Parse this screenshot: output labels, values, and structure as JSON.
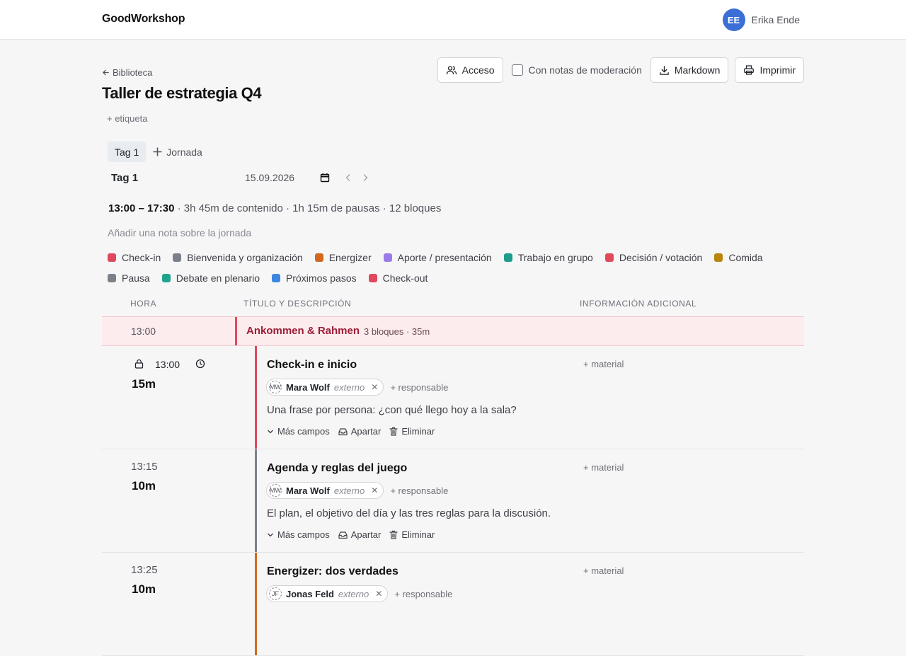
{
  "app": {
    "brand": "GoodWorkshop"
  },
  "user": {
    "initials": "EE",
    "name": "Erika Ende"
  },
  "header": {
    "back_label": "Biblioteca",
    "title": "Taller de estrategia Q4",
    "add_tag": "+ etiqueta"
  },
  "toolbar": {
    "access_label": "Acceso",
    "moderation_label": "Con notas de moderación",
    "moderation_checked": false,
    "markdown_label": "Markdown",
    "print_label": "Imprimir"
  },
  "days": {
    "tabs": [
      {
        "label": "Tag 1",
        "active": true
      }
    ],
    "add_label": "Jornada"
  },
  "day": {
    "name": "Tag 1",
    "date": "15.09.2026",
    "time_range": "13:00 – 17:30",
    "summary": " · 3h 45m de contenido · 1h 15m de pausas · 12 bloques",
    "note_placeholder": "Añadir una nota sobre la jornada"
  },
  "legend": [
    {
      "label": "Check-in",
      "color": "#e0485e"
    },
    {
      "label": "Bienvenida y organización",
      "color": "#7b8089"
    },
    {
      "label": "Energizer",
      "color": "#d2691e"
    },
    {
      "label": "Aporte / presentación",
      "color": "#9b7be8"
    },
    {
      "label": "Trabajo en grupo",
      "color": "#1f9c8a"
    },
    {
      "label": "Decisión / votación",
      "color": "#e04a5a"
    },
    {
      "label": "Comida",
      "color": "#b8860b"
    },
    {
      "label": "Pausa",
      "color": "#7b8089"
    },
    {
      "label": "Debate en plenario",
      "color": "#1fa38f"
    },
    {
      "label": "Próximos pasos",
      "color": "#3a86e0"
    },
    {
      "label": "Check-out",
      "color": "#e0485e"
    }
  ],
  "table": {
    "headers": {
      "time": "HORA",
      "title": "TÍTULO Y DESCRIPCIÓN",
      "info": "INFORMACIÓN ADICIONAL"
    }
  },
  "group": {
    "time": "13:00",
    "name": "Ankommen & Rahmen",
    "meta": "3 bloques · 35m",
    "color": "#e0485e"
  },
  "blocks": [
    {
      "time": "13:00",
      "duration": "15m",
      "locked": true,
      "title": "Check-in e inicio",
      "color": "#e0485e",
      "person": {
        "initials": "MW",
        "name": "Mara Wolf",
        "role": "externo"
      },
      "add_responsible": "+ responsable",
      "description": "Una frase por persona: ¿con qué llego hoy a la sala?",
      "actions": {
        "more": "Más campos",
        "park": "Apartar",
        "delete": "Eliminar"
      },
      "material": "+ material"
    },
    {
      "time": "13:15",
      "duration": "10m",
      "locked": false,
      "title": "Agenda y reglas del juego",
      "color": "#7b8089",
      "person": {
        "initials": "MW",
        "name": "Mara Wolf",
        "role": "externo"
      },
      "add_responsible": "+ responsable",
      "description": "El plan, el objetivo del día y las tres reglas para la discusión.",
      "actions": {
        "more": "Más campos",
        "park": "Apartar",
        "delete": "Eliminar"
      },
      "material": "+ material"
    },
    {
      "time": "13:25",
      "duration": "10m",
      "locked": false,
      "title": "Energizer: dos verdades",
      "color": "#d2691e",
      "person": {
        "initials": "JF",
        "name": "Jonas Feld",
        "role": "externo"
      },
      "add_responsible": "+ responsable",
      "material": "+ material"
    }
  ]
}
